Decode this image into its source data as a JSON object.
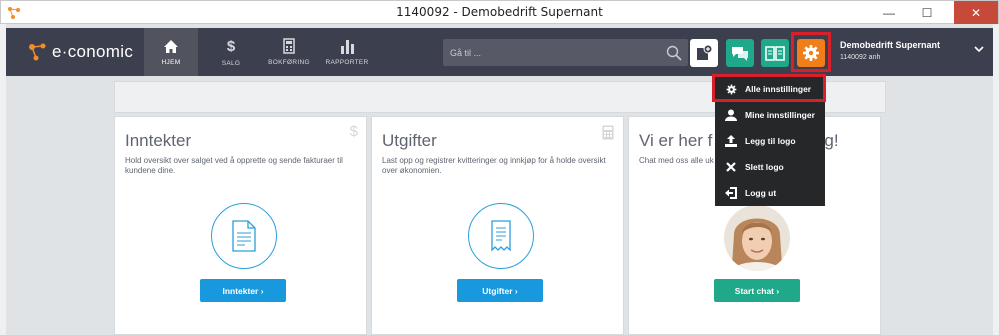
{
  "window": {
    "title": "1140092 - Demobedrift Supernant",
    "minimize": "—",
    "maximize": "☐",
    "close": "✕"
  },
  "brand": {
    "name": "e·conomic",
    "accent": "#f28c28"
  },
  "nav": {
    "items": [
      {
        "label": "HJEM",
        "icon": "home-icon"
      },
      {
        "label": "SALG",
        "icon": "dollar-icon"
      },
      {
        "label": "BOKFØRING",
        "icon": "calculator-icon"
      },
      {
        "label": "RAPPORTER",
        "icon": "bar-chart-icon"
      }
    ]
  },
  "search": {
    "placeholder": "Gå til ..."
  },
  "user": {
    "name": "Demobedrift Supernant",
    "sub": "1140092 anh"
  },
  "dropdown": {
    "items": [
      {
        "label": "Alle innstillinger",
        "icon": "gear-icon"
      },
      {
        "label": "Mine innstillinger",
        "icon": "user-icon"
      },
      {
        "label": "Legg til logo",
        "icon": "upload-icon"
      },
      {
        "label": "Slett logo",
        "icon": "delete-icon"
      },
      {
        "label": "Logg ut",
        "icon": "logout-icon"
      }
    ]
  },
  "cards": {
    "income": {
      "title": "Inntekter",
      "desc": "Hold oversikt over salget ved å opprette og sende fakturaer til kundene dine.",
      "button": "Inntekter ›"
    },
    "expenses": {
      "title": "Utgifter",
      "desc": "Last opp og registrer kvitteringer og innkjøp for å holde oversikt over økonomien.",
      "button": "Utgifter ›"
    },
    "chat": {
      "title": "Vi er her for deg!",
      "title_visible": "Vi er her f",
      "title_tail": "g!",
      "desc": "Chat med oss alle uk",
      "button": "Start chat ›"
    }
  },
  "colors": {
    "nav_bg": "#3c3f4d",
    "blue": "#1898dd",
    "green": "#1fa88a",
    "orange": "#f07f1a",
    "highlight": "#d8202b"
  }
}
